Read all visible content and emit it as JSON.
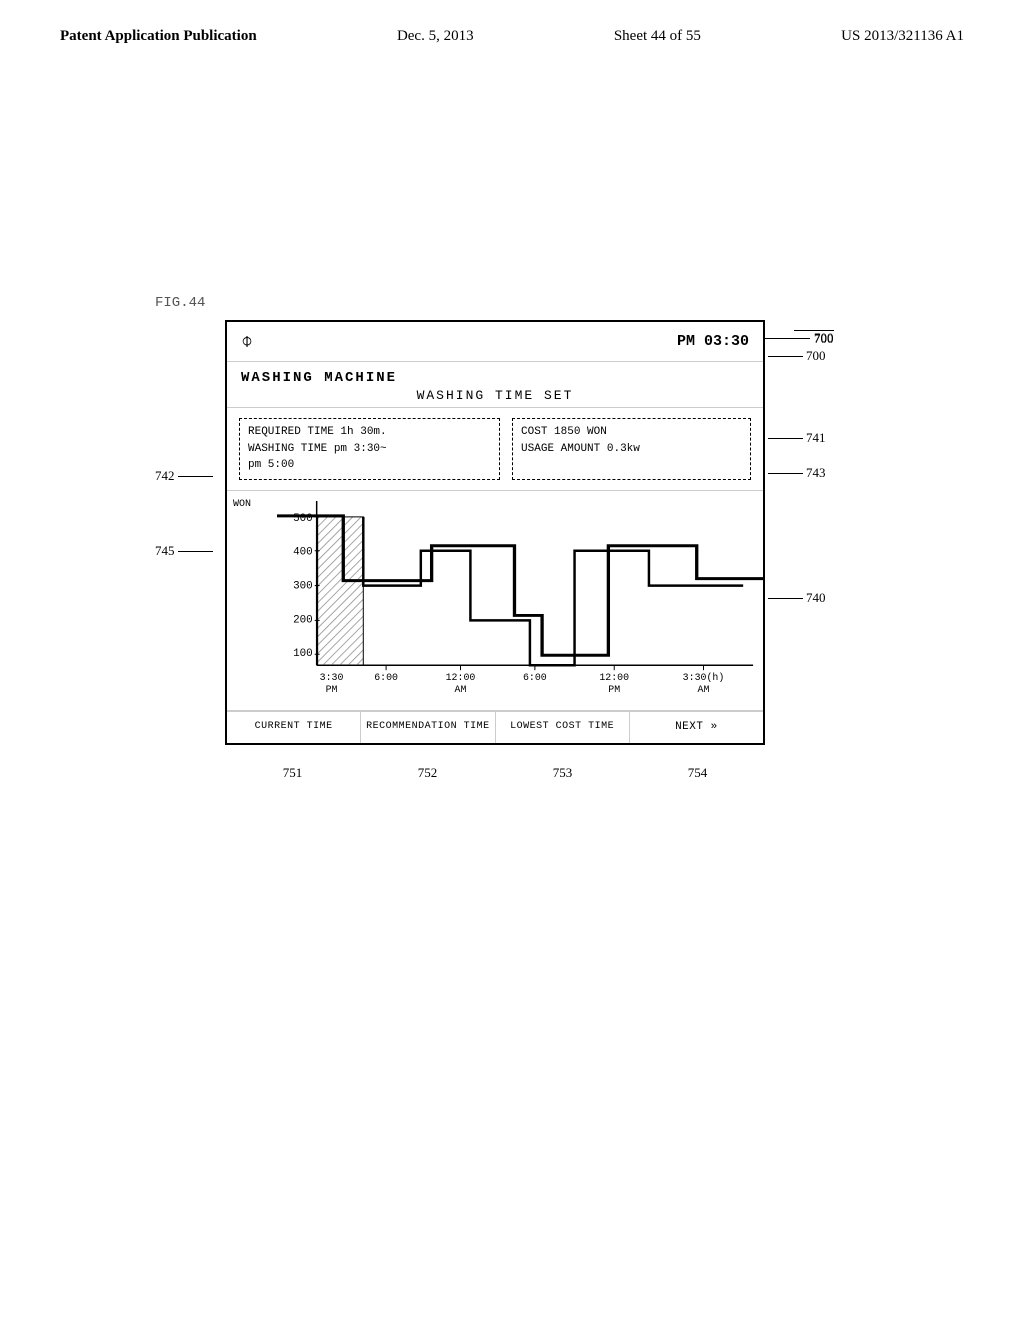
{
  "header": {
    "left": "Patent Application Publication",
    "center": "Dec. 5, 2013",
    "sheet": "Sheet 44 of 55",
    "right": "US 2013/321136 A1"
  },
  "fig_label": "FIG.44",
  "device": {
    "time": "PM 03:30",
    "appliance": "WASHING  MACHINE",
    "subtitle": "WASHING  TIME  SET",
    "info_left": {
      "line1": "REQUIRED TIME  1h 30m.",
      "line2": "WASHING TIME   pm 3:30~",
      "line3": "               pm 5:00"
    },
    "info_right": {
      "line1": "COST  1850 WON",
      "line2": "USAGE AMOUNT  0.3kw"
    },
    "chart": {
      "y_label": "WON",
      "y_ticks": [
        "500",
        "400",
        "300",
        "200",
        "100"
      ],
      "x_labels": [
        {
          "text": "3:30",
          "sub": "PM"
        },
        {
          "text": "6:00",
          "sub": ""
        },
        {
          "text": "12:00",
          "sub": "AM"
        },
        {
          "text": "6:00",
          "sub": ""
        },
        {
          "text": "12:00",
          "sub": "PM"
        },
        {
          "text": "3:30(h)",
          "sub": "AM"
        }
      ]
    },
    "buttons": [
      {
        "id": "751",
        "label": "CURRENT\nTIME"
      },
      {
        "id": "752",
        "label": "RECOMMENDATION\nTIME"
      },
      {
        "id": "753",
        "label": "LOWEST\nCOST TIME"
      },
      {
        "id": "754",
        "label": "NEXT »"
      }
    ]
  },
  "ref_numbers": {
    "r700": "700",
    "r740": "740",
    "r741": "741",
    "r742": "742",
    "r743": "743",
    "r745": "745",
    "r751": "751",
    "r752": "752",
    "r753": "753",
    "r754": "754"
  }
}
